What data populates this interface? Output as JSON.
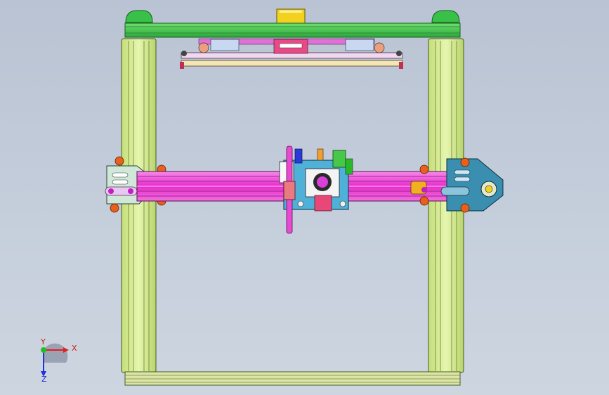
{
  "viewport": {
    "background_color": "#c3ccda",
    "model": {
      "frame_color": "#d4ec8a",
      "top_beam_color": "#3ec24a",
      "gantry_beam_color": "#ee2ad0",
      "plate_color": "#3a8fb0",
      "bracket_color": "#c8e4d4",
      "wheel_color": "#e8601c",
      "motor_color": "#f0d020"
    }
  },
  "triad": {
    "x_label": "X",
    "y_label": "Y",
    "z_label": "Z",
    "x_color": "#e02020",
    "y_color": "#20c020",
    "z_color": "#2030e0"
  }
}
